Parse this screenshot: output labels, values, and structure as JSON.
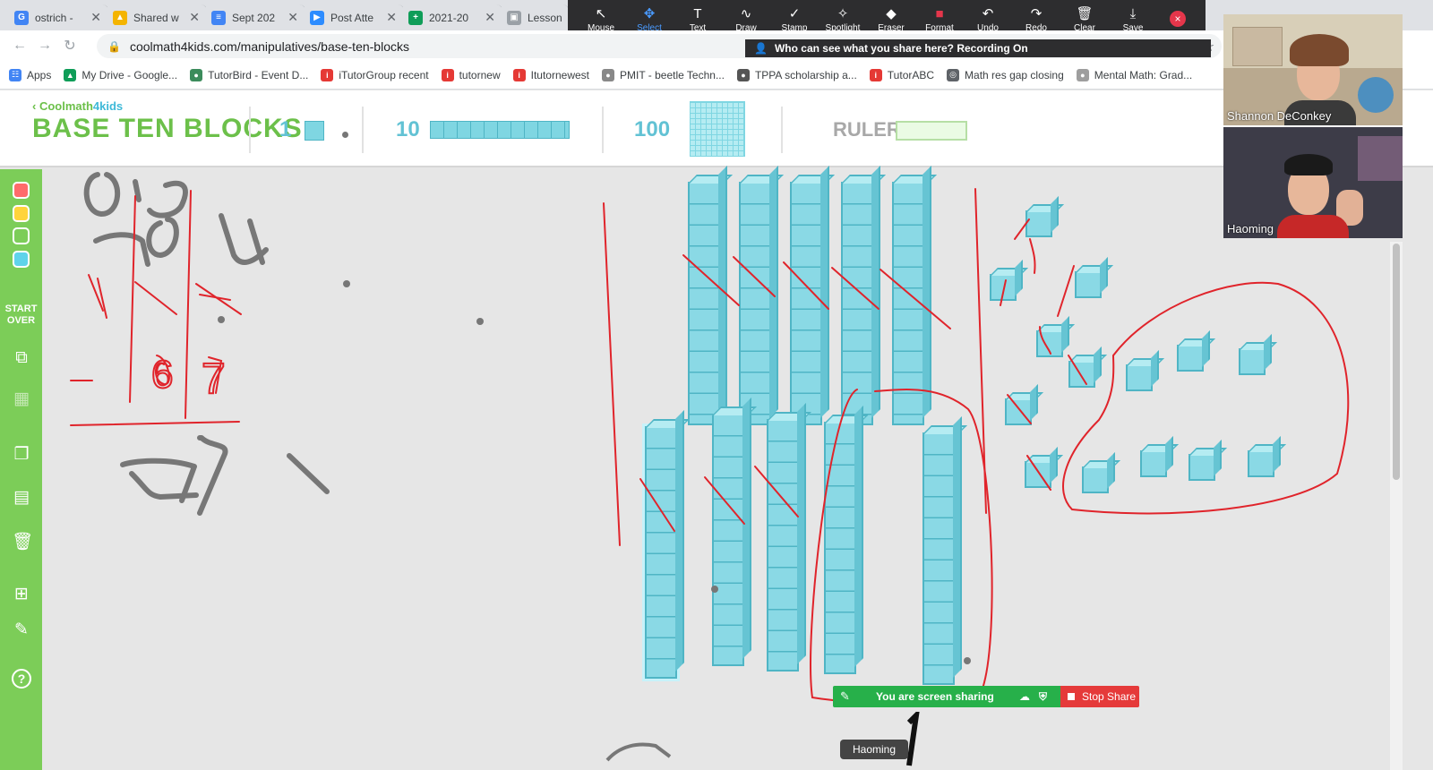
{
  "tabs": [
    {
      "label": "ostrich -",
      "fav": "G",
      "color": "#4285f4"
    },
    {
      "label": "Shared w",
      "fav": "▲",
      "color": "#f4b400"
    },
    {
      "label": "Sept 202",
      "fav": "≡",
      "color": "#4285f4"
    },
    {
      "label": "Post Atte",
      "fav": "▶",
      "color": "#2d8cff"
    },
    {
      "label": "2021-20",
      "fav": "+",
      "color": "#0f9d58"
    },
    {
      "label": "Lessons",
      "fav": "▣",
      "color": "#9aa0a6"
    }
  ],
  "browser": {
    "url": "coolmath4kids.com/manipulatives/base-ten-blocks",
    "back_icon": "←",
    "forward_icon": "→",
    "reload_icon": "↻",
    "star_icon": "☆",
    "lock_icon": "🔒"
  },
  "bookmarks": [
    {
      "label": "Apps",
      "icon": "☷",
      "color": "#4285f4"
    },
    {
      "label": "My Drive - Google...",
      "icon": "▲",
      "color": "#0f9d58"
    },
    {
      "label": "TutorBird - Event D...",
      "icon": "●",
      "color": "#3c8c5c"
    },
    {
      "label": "iTutorGroup recent",
      "icon": "i",
      "color": "#e53935"
    },
    {
      "label": "tutornew",
      "icon": "i",
      "color": "#e53935"
    },
    {
      "label": "Itutornewest",
      "icon": "i",
      "color": "#e53935"
    },
    {
      "label": "PMIT - beetle Techn...",
      "icon": "●",
      "color": "#888888"
    },
    {
      "label": "TPPA scholarship a...",
      "icon": "●",
      "color": "#555555"
    },
    {
      "label": "TutorABC",
      "icon": "i",
      "color": "#e53935"
    },
    {
      "label": "Math res gap closing",
      "icon": "◎",
      "color": "#5f6368"
    },
    {
      "label": "Mental Math: Grad...",
      "icon": "●",
      "color": "#9e9e9e"
    }
  ],
  "zoom_toolbar": {
    "tools": [
      {
        "label": "Mouse",
        "icon": "↖"
      },
      {
        "label": "Select",
        "icon": "✥"
      },
      {
        "label": "Text",
        "icon": "T"
      },
      {
        "label": "Draw",
        "icon": "∿"
      },
      {
        "label": "Stamp",
        "icon": "✓"
      },
      {
        "label": "Spotlight",
        "icon": "✧"
      },
      {
        "label": "Eraser",
        "icon": "◆"
      },
      {
        "label": "Format",
        "icon": "■"
      },
      {
        "label": "Undo",
        "icon": "↶"
      },
      {
        "label": "Redo",
        "icon": "↷"
      },
      {
        "label": "Clear",
        "icon": "🗑"
      },
      {
        "label": "Save",
        "icon": "⤓"
      }
    ],
    "active_tool": "Select",
    "close_icon": "×",
    "notice": "Who can see what you share here? Recording On"
  },
  "app": {
    "back_label": "Coolmath",
    "back_label_4": "4",
    "back_label_kids": "kids",
    "title": "BASE TEN BLOCKS",
    "block_one": "1",
    "block_ten": "10",
    "block_hundred": "100",
    "ruler": "RULER"
  },
  "sidebar": {
    "swatch_colors": [
      "#ff6b6b",
      "#ffd43b",
      "#ffffff",
      "#5fd3ea"
    ],
    "start_over_1": "START",
    "start_over_2": "OVER",
    "tool_icons": [
      {
        "name": "group-icon",
        "glyph": "⧉"
      },
      {
        "name": "grid-icon",
        "glyph": "▦"
      },
      {
        "name": "duplicate-icon",
        "glyph": "❐"
      },
      {
        "name": "rotate-grid-icon",
        "glyph": "▤"
      },
      {
        "name": "trash-icon",
        "glyph": "🗑"
      },
      {
        "name": "add-blocks-icon",
        "glyph": "⊞"
      },
      {
        "name": "pencil-icon",
        "glyph": "✎"
      },
      {
        "name": "help-icon",
        "glyph": "?"
      }
    ]
  },
  "sharing": {
    "status": "You are screen sharing",
    "stop": "Stop Share",
    "name_chip": "Haoming"
  },
  "participants": [
    {
      "name": "Shannon DeConkey"
    },
    {
      "name": "Haoming"
    }
  ]
}
